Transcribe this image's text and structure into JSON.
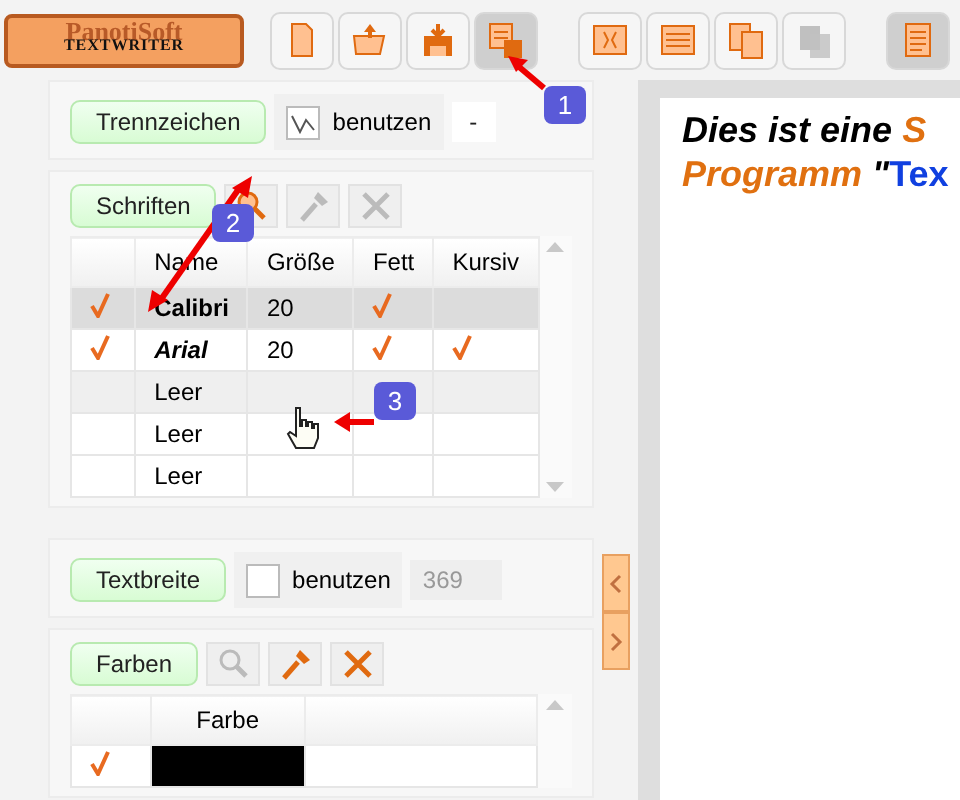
{
  "logo": {
    "brand": "PanotiSoft",
    "product": "TEXTWRITER"
  },
  "toolbar": [
    {
      "kind": "new",
      "pressed": false,
      "disabled": false
    },
    {
      "kind": "open",
      "pressed": false,
      "disabled": false
    },
    {
      "kind": "save",
      "pressed": false,
      "disabled": false
    },
    {
      "kind": "saveas",
      "pressed": true,
      "disabled": false
    },
    {
      "kind": "sep"
    },
    {
      "kind": "fit",
      "pressed": false,
      "disabled": false
    },
    {
      "kind": "lines",
      "pressed": false,
      "disabled": false
    },
    {
      "kind": "copy",
      "pressed": false,
      "disabled": false
    },
    {
      "kind": "paste",
      "pressed": false,
      "disabled": true
    },
    {
      "kind": "sep"
    },
    {
      "kind": "page",
      "pressed": true,
      "disabled": false
    }
  ],
  "separator": {
    "label": "Trennzeichen",
    "checkbox_label": "benutzen",
    "checked": true,
    "value": "-"
  },
  "fonts": {
    "label": "Schriften",
    "tools": [
      {
        "kind": "search",
        "disabled": false
      },
      {
        "kind": "pin",
        "disabled": true
      },
      {
        "kind": "delete",
        "disabled": true
      }
    ],
    "columns": [
      "",
      "Name",
      "Größe",
      "Fett",
      "Kursiv"
    ],
    "rows": [
      {
        "active": true,
        "name": "Calibri",
        "size": "20",
        "bold": true,
        "italic": false,
        "selected": true
      },
      {
        "active": true,
        "name": "Arial",
        "size": "20",
        "bold": true,
        "italic": true,
        "selected": false
      },
      {
        "active": false,
        "name": "Leer",
        "bold": false,
        "italic": false,
        "selected": false,
        "hover": true
      },
      {
        "active": false,
        "name": "Leer",
        "bold": false,
        "italic": false,
        "selected": false
      },
      {
        "active": false,
        "name": "Leer",
        "bold": false,
        "italic": false,
        "selected": false
      }
    ]
  },
  "text_width": {
    "label": "Textbreite",
    "checkbox_label": "benutzen",
    "checked": false,
    "value": "369"
  },
  "colors": {
    "label": "Farben",
    "tools": [
      {
        "kind": "search",
        "disabled": true
      },
      {
        "kind": "pin",
        "disabled": false
      },
      {
        "kind": "delete",
        "disabled": false
      }
    ],
    "columns": [
      "",
      "Farbe",
      ""
    ],
    "rows": [
      {
        "active": true,
        "color": "#000000"
      }
    ]
  },
  "document": {
    "lines": [
      [
        {
          "text": "Dies ist eine ",
          "color": "#000000",
          "italic": true
        },
        {
          "text": "S",
          "color": "#e07010",
          "italic": true
        }
      ],
      [
        {
          "text": "Programm",
          "color": "#e07010",
          "italic": true
        },
        {
          "text": " \"",
          "color": "#000000",
          "italic": true
        },
        {
          "text": "Tex",
          "color": "#1040e0",
          "italic": false
        }
      ]
    ]
  },
  "callouts": [
    "1",
    "2",
    "3"
  ]
}
